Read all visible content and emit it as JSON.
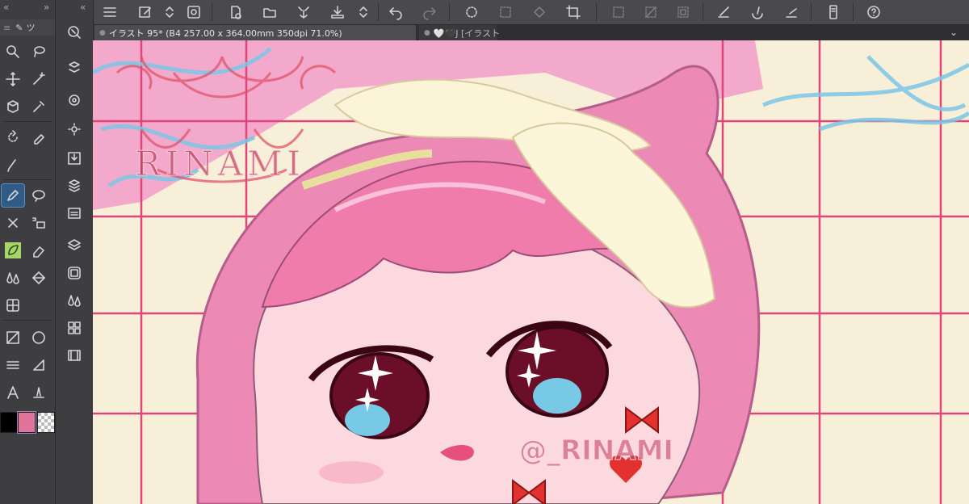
{
  "canvas": {
    "document_tab_title": "イラスト 95* (B4 257.00 x 364.00mm 350dpi 71.0%)",
    "second_tab_title": "🤍🖤J [イラスト",
    "watermark_logo_text": "RINAMI",
    "watermark_handle": "@_RINAMI"
  },
  "tool_panel": {
    "subtool_label": "ツ",
    "main_color": "#000000",
    "sub_color": "#e0749b"
  },
  "colors": {
    "ui_bg": "#3e3e40",
    "grid_line": "#e0457a",
    "grid_bg": "#f8efd8",
    "hair_pink": "#f09ac0",
    "bg_pink": "#f2a9cb",
    "sky_blue": "#7cc7e8"
  }
}
